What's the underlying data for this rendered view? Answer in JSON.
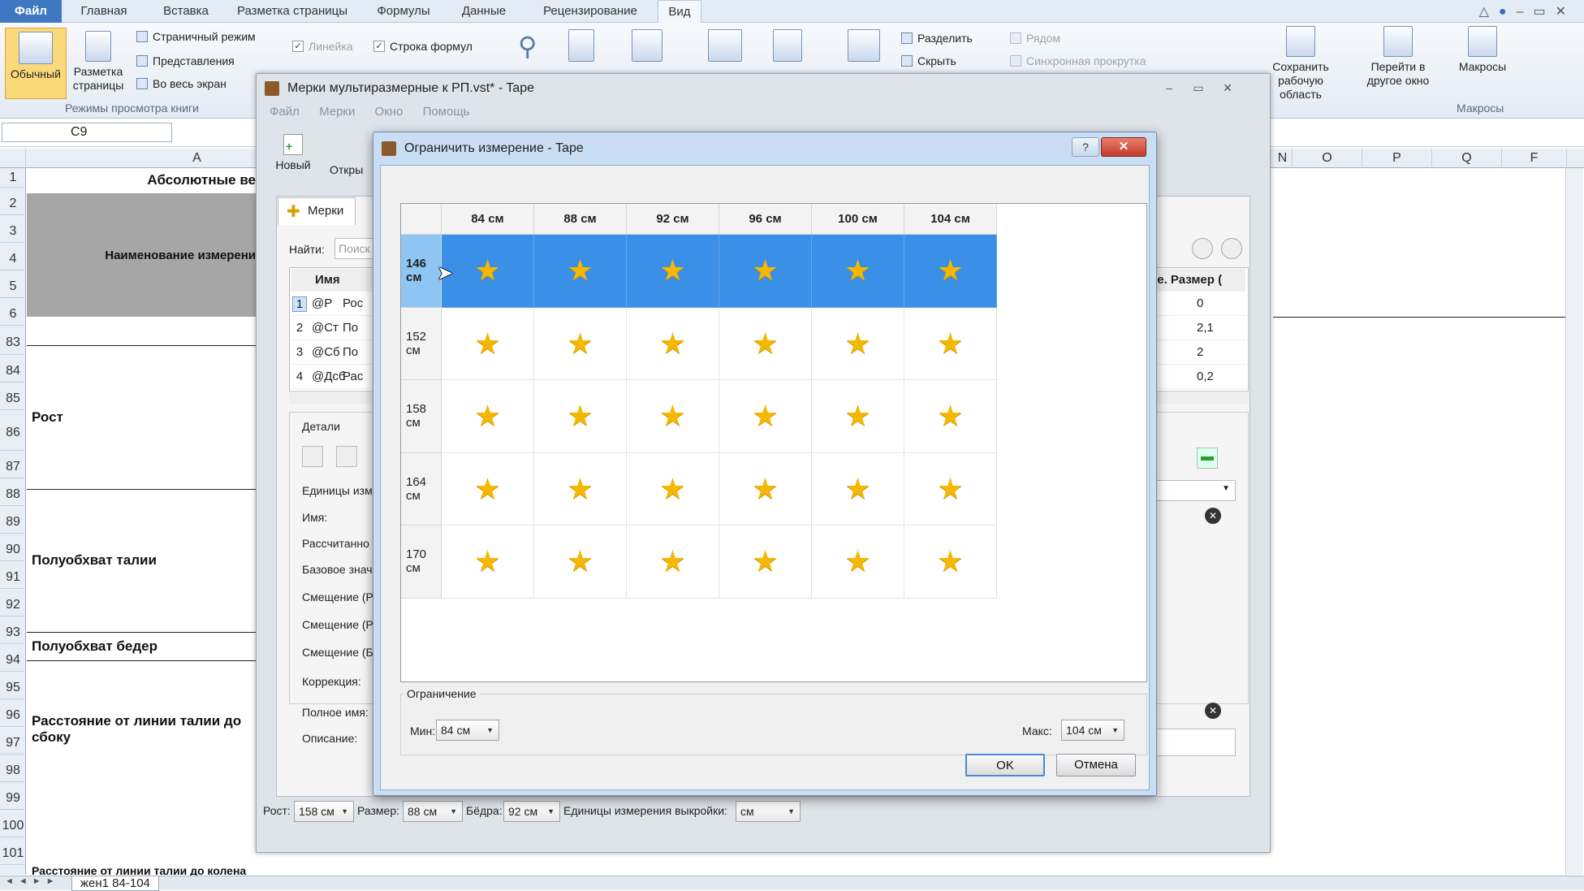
{
  "excel": {
    "tabs": [
      "Файл",
      "Главная",
      "Вставка",
      "Разметка страницы",
      "Формулы",
      "Данные",
      "Рецензирование",
      "Вид"
    ],
    "ribbon": {
      "normal_label": "Обычный",
      "page_layout_label": "Разметка страницы",
      "page_mode_label": "Страничный режим",
      "views_label": "Представления",
      "fullscreen_label": "Во весь экран",
      "group_view_modes": "Режимы просмотра книги",
      "ruler_label": "Линейка",
      "formula_bar_label": "Строка формул",
      "split_label": "Разделить",
      "hide_label": "Скрыть",
      "side_label": "Рядом",
      "sync_scroll_label": "Синхронная прокрутка",
      "save_area_label": "Сохранить рабочую область",
      "switch_window_label": "Перейти в другое окно",
      "macros_label": "Макросы",
      "macros_group": "Макросы"
    },
    "namebox": "C9",
    "columns": [
      "A",
      "N",
      "O",
      "P",
      "Q",
      "F"
    ],
    "rows": [
      "1",
      "2",
      "3",
      "4",
      "5",
      "6",
      "83",
      "84",
      "85",
      "86",
      "87",
      "88",
      "89",
      "90",
      "91",
      "92",
      "93",
      "94",
      "95",
      "96",
      "97",
      "98",
      "99",
      "100",
      "101"
    ],
    "cells": {
      "title": "Абсолютные ве",
      "header": "Наименование измерени",
      "rost": "Рост",
      "waist": "Полуобхват талии",
      "hips": "Полуобхват бедер",
      "distance": "Расстояние от линии талии до сбоку",
      "bottom": "Расстояние от линии талии до колена"
    },
    "sheet_tab": "жен1 84-104"
  },
  "tape": {
    "title": "Мерки мультиразмерные к РП.vst* - Tape",
    "menu": [
      "Файл",
      "Мерки",
      "Окно",
      "Помощь"
    ],
    "new_label": "Новый",
    "open_label": "Откры",
    "tab_label": "Мерки",
    "find_label": "Найти:",
    "find_placeholder": "Поиск",
    "table_header_name": "Имя",
    "table_header_size": "ие. Размер (",
    "rows": [
      {
        "n": "1",
        "name": "@Р",
        "desc": "Рос",
        "value": "0"
      },
      {
        "n": "2",
        "name": "@Ст",
        "desc": "По",
        "value": "2,1"
      },
      {
        "n": "3",
        "name": "@Сб",
        "desc": "По",
        "value": "2"
      },
      {
        "n": "4",
        "name": "@Дсб",
        "desc": "Рас",
        "value": "0,2"
      }
    ],
    "details_label": "Детали",
    "units_label": "Единицы изм",
    "name_label": "Имя:",
    "calc_label": "Рассчитанно",
    "base_label": "Базовое знач",
    "shift1_label": "Смещение (Р",
    "shift2_label": "Смещение (Р",
    "shift3_label": "Смещение (Б",
    "correction_label": "Коррекция:",
    "fullname_label": "Полное имя:",
    "description_label": "Описание:",
    "bottom": {
      "height_label": "Рост:",
      "height_value": "158 см",
      "size_label": "Размер:",
      "size_value": "88 см",
      "hips_label": "Бёдра:",
      "hips_value": "92 см",
      "units_label": "Единицы измерения выкройки:",
      "units_value": "см"
    }
  },
  "dialog": {
    "title": "Ограничить измерение - Tape",
    "columns": [
      "84 см",
      "88 см",
      "92 см",
      "96 см",
      "100 см",
      "104 см"
    ],
    "rows": [
      "146 см",
      "152 см",
      "158 см",
      "164 см",
      "170 см"
    ],
    "selected_row": 0,
    "star": "★",
    "group_label": "Ограничение",
    "min_label": "Мин:",
    "min_value": "84 см",
    "max_label": "Макс:",
    "max_value": "104 см",
    "ok_label": "OK",
    "cancel_label": "Отмена",
    "help_icon": "question-icon",
    "close_icon": "close-icon"
  }
}
